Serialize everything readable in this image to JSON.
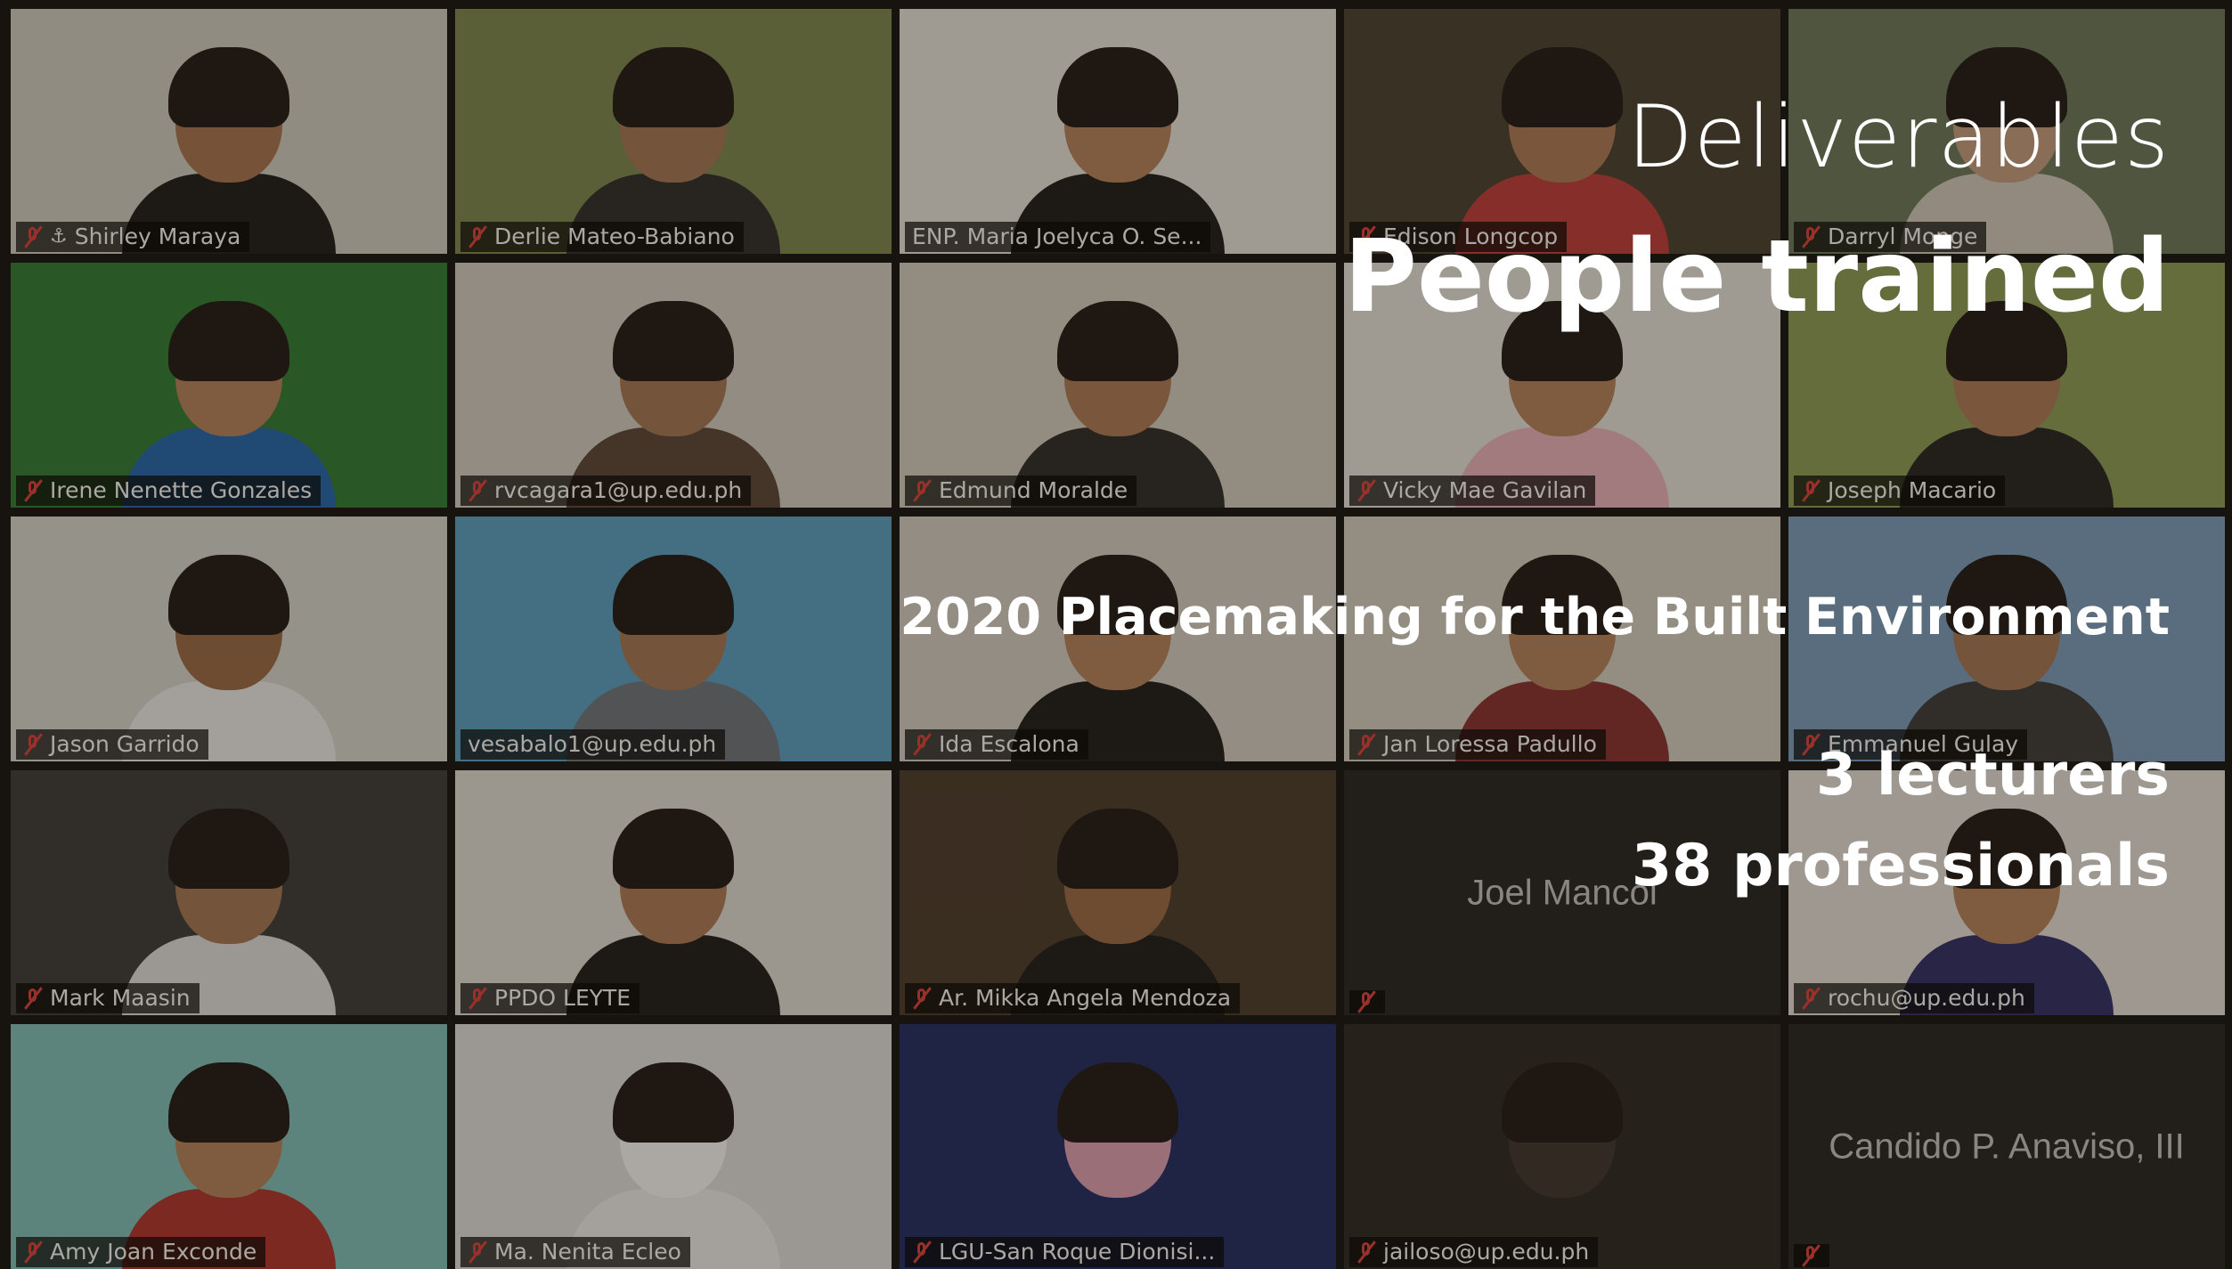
{
  "participants": [
    {
      "name": "Shirley Maraya",
      "muted": true,
      "pinned": true,
      "active": true,
      "bg": "#d6d2c8",
      "skin": "#a87552",
      "shirt": "#1a1a1a"
    },
    {
      "name": "Derlie Mateo-Babiano",
      "muted": true,
      "bg": "#7c8a4f",
      "skin": "#a77a58",
      "shirt": "#2d2d2d"
    },
    {
      "name": "ENP. Maria Joelyca O. Se...",
      "muted": false,
      "bg": "#ecebe4",
      "skin": "#b9845e",
      "shirt": "#1a1a1a"
    },
    {
      "name": "Edison Longcop",
      "muted": true,
      "bg": "#4a3f33",
      "skin": "#b07c58",
      "shirt": "#c23a3a"
    },
    {
      "name": "Darryl Monge",
      "muted": true,
      "bg": "#6d7a5c",
      "skin": "#c8a183",
      "shirt": "#d8cfc4"
    },
    {
      "name": "Irene Nenette Gonzales",
      "muted": true,
      "bg": "#2e7d32",
      "skin": "#b9845e",
      "shirt": "#1f66b0"
    },
    {
      "name": "rvcagara1@up.edu.ph",
      "muted": true,
      "bg": "#d7d2c8",
      "skin": "#a77a58",
      "shirt": "#5a4637"
    },
    {
      "name": "Edmund Moralde",
      "muted": true,
      "bg": "#d8d2c6",
      "skin": "#b07c58",
      "shirt": "#2a2a2a"
    },
    {
      "name": "Vicky Mae Gavilan",
      "muted": true,
      "bg": "#eceae2",
      "skin": "#b9845e",
      "shirt": "#f0b6c3"
    },
    {
      "name": "Joseph Macario",
      "muted": true,
      "bg": "#8fa05a",
      "skin": "#b07c58",
      "shirt": "#222222"
    },
    {
      "name": "Jason Garrido",
      "muted": true,
      "bg": "#dcdcd6",
      "skin": "#9c6b48",
      "shirt": "#f2f2f2"
    },
    {
      "name": "vesabalo1@up.edu.ph",
      "muted": false,
      "bg": "#5aa4c9",
      "skin": "#a77a58",
      "shirt": "#6f7680"
    },
    {
      "name": "Ida Escalona",
      "muted": true,
      "bg": "#d8d4cc",
      "skin": "#b9845e",
      "shirt": "#1a1a1a"
    },
    {
      "name": "Jan Loressa Padullo",
      "muted": true,
      "bg": "#d9d3c8",
      "skin": "#b9845e",
      "shirt": "#8a2f2f"
    },
    {
      "name": "Emmanuel Gulay",
      "muted": true,
      "bg": "#7ca0c2",
      "skin": "#a77a58",
      "shirt": "#3a3a3a"
    },
    {
      "name": "Mark Maasin",
      "muted": true,
      "bg": "#3a3a3a",
      "skin": "#a77a58",
      "shirt": "#e6e6e6"
    },
    {
      "name": "PPDO LEYTE",
      "muted": true,
      "bg": "#e6e4de",
      "skin": "#b07c58",
      "shirt": "#1a1a1a"
    },
    {
      "name": "Ar. Mikka Angela Mendoza",
      "muted": true,
      "bg": "#4a3a2c",
      "skin": "#9c6b48",
      "shirt": "#1a1a1a"
    },
    {
      "name": "Joel Mancol",
      "muted": true,
      "blank": true,
      "label": "",
      "bg": "#222222"
    },
    {
      "name": "rochu@up.edu.ph",
      "muted": true,
      "bg": "#ebe6e0",
      "skin": "#b9845e",
      "shirt": "#2c2c6a"
    },
    {
      "name": "Amy Joan Exconde",
      "muted": true,
      "bg": "#82c4c0",
      "skin": "#b9845e",
      "shirt": "#b2322c"
    },
    {
      "name": "Ma. Nenita Ecleo",
      "muted": true,
      "bg": "#e6e6e6",
      "skin": "#ffffff",
      "shirt": "#f4f4f4"
    },
    {
      "name": "LGU-San Roque  Dionisi...",
      "muted": true,
      "bg": "#1e2a66",
      "skin": "#e6a3b6",
      "shirt": "#1e2a66"
    },
    {
      "name": "jailoso@up.edu.ph",
      "muted": true,
      "bg": "#2b2622",
      "skin": "#3d352e",
      "shirt": "#2b2622"
    },
    {
      "name": "Candido P. Anaviso, III",
      "muted": true,
      "blank": true,
      "label": "",
      "bg": "#222222"
    }
  ],
  "slide": {
    "heading": "Deliverables",
    "title": "People trained",
    "course": "2020 Placemaking for the Built Environment",
    "lecturers": "3 lecturers",
    "professionals": "38 professionals"
  }
}
